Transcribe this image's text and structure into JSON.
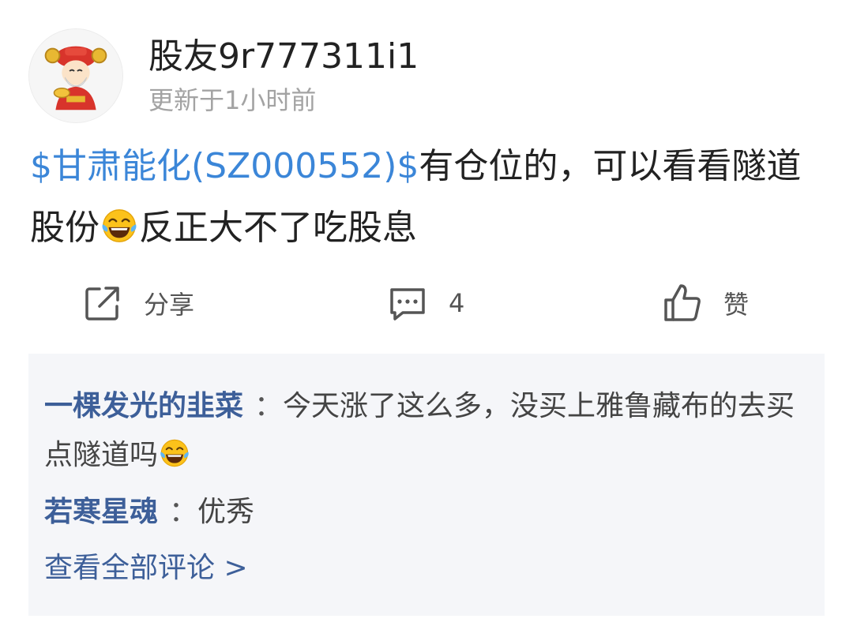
{
  "post": {
    "author": {
      "name": "股友9r777311i1",
      "updated": "更新于1小时前"
    },
    "content": {
      "stock_tag": "$甘肃能化(SZ000552)$",
      "text_part1": "有仓位的，可以看看隧道股份",
      "text_part2": "反正大不了吃股息",
      "emoji": "laughing-with-tears"
    },
    "actions": {
      "share_label": "分享",
      "comment_count": "4",
      "like_label": "赞"
    }
  },
  "comments": {
    "items": [
      {
        "user": "一棵发光的韭菜",
        "separator": "：",
        "text": "今天涨了这么多，没买上雅鲁藏布的去买点隧道吗",
        "emoji": "laughing-with-tears"
      },
      {
        "user": "若寒星魂",
        "separator": "：",
        "text": "优秀"
      }
    ],
    "view_all_label": "查看全部评论 >"
  },
  "colors": {
    "link_blue": "#3b86d8",
    "commenter_blue": "#3d5f99",
    "muted_gray": "#a3a3a3",
    "comment_bg": "#f5f6f9"
  }
}
